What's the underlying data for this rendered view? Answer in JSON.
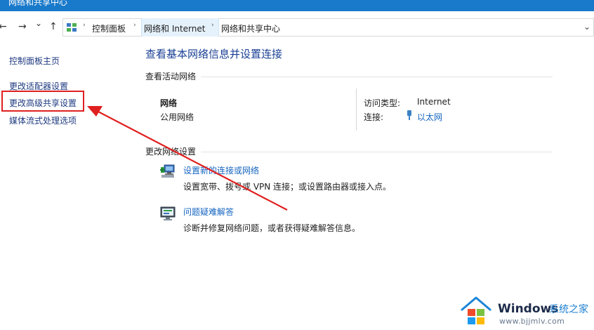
{
  "window": {
    "title": "网络和共享中心"
  },
  "nav": {
    "back_icon": "←",
    "forward_icon": "→",
    "recent_icon": "⌄",
    "up_icon": "↑"
  },
  "address": {
    "breadcrumb": [
      "控制面板",
      "网络和 Internet",
      "网络和共享中心"
    ],
    "separator": "›",
    "dropdown_icon": "⌄"
  },
  "sidebar": {
    "items": [
      "控制面板主页",
      "更改适配器设置",
      "更改高级共享设置",
      "媒体流式处理选项"
    ]
  },
  "main": {
    "title": "查看基本网络信息并设置连接",
    "active_networks_heading": "查看活动网络",
    "network": {
      "name": "网络",
      "type": "公用网络",
      "access_type_label": "访问类型:",
      "access_type_value": "Internet",
      "connections_label": "连接:",
      "connection_value": "以太网"
    },
    "change_settings_heading": "更改网络设置",
    "tasks": [
      {
        "link": "设置新的连接或网络",
        "description": "设置宽带、拨号或 VPN 连接；或设置路由器或接入点。"
      },
      {
        "link": "问题疑难解答",
        "description": "诊断并修复网络问题，或者获得疑难解答信息。"
      }
    ]
  },
  "colors": {
    "accent": "#1565c0",
    "annotation": "#e02020"
  },
  "watermark": {
    "brand": "Windows",
    "site_name": "系统之家",
    "url": "www.bjjmlv.com"
  }
}
